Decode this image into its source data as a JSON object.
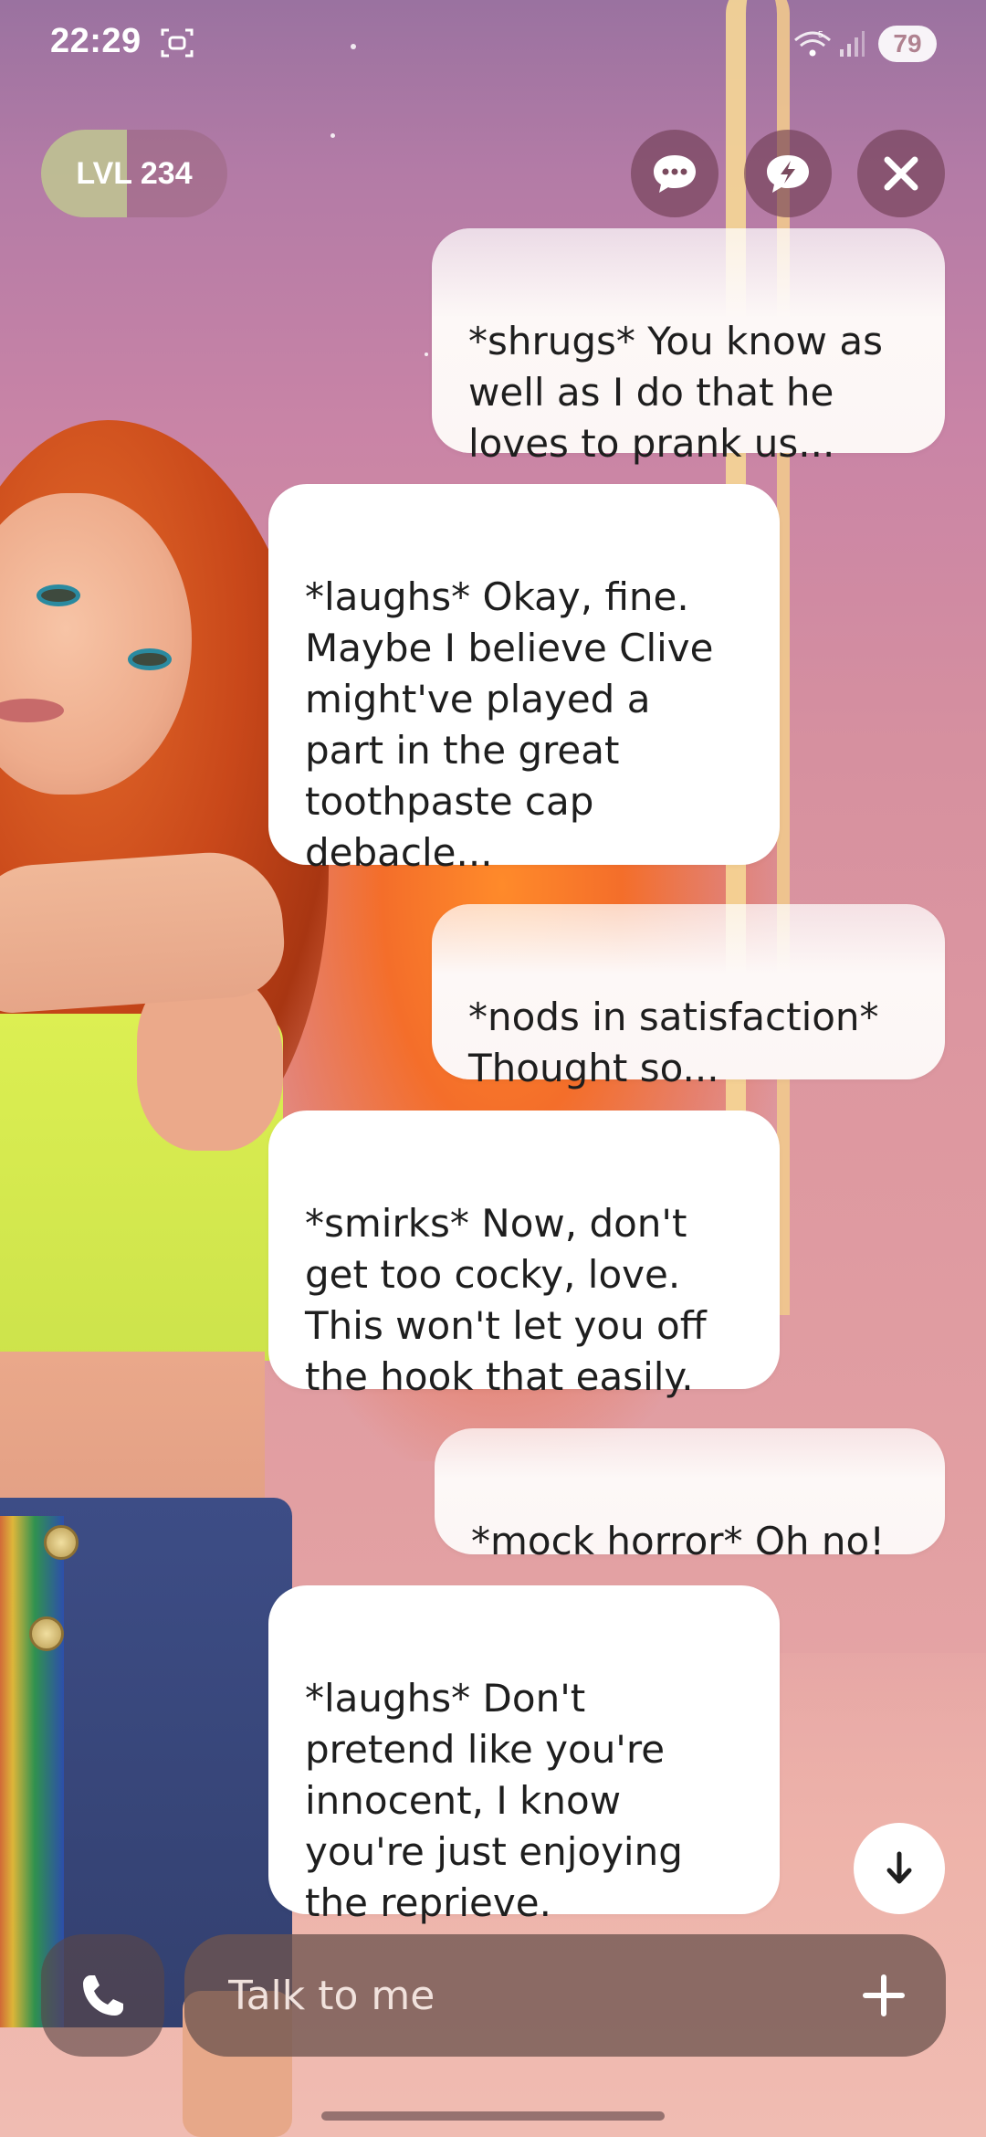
{
  "status_bar": {
    "time": "22:29",
    "battery": "79",
    "icons": [
      "screenshot-icon",
      "wifi-icon",
      "signal-icon",
      "battery-icon"
    ]
  },
  "header": {
    "level_label": "LVL 234",
    "level_progress": 0.46,
    "buttons": [
      "chat-bubble-icon",
      "lightning-bubble-icon",
      "close-icon"
    ]
  },
  "messages": [
    {
      "sender": "user",
      "text": "*shrugs* You know as\nwell as I do that he\nloves to prank us..."
    },
    {
      "sender": "ai",
      "text": "*laughs* Okay, fine.\nMaybe I believe Clive\nmight've played a\npart in the great\ntoothpaste cap\ndebacle..."
    },
    {
      "sender": "user",
      "text": "*nods in satisfaction*\nThought so..."
    },
    {
      "sender": "ai",
      "text": "*smirks* Now, don't\nget too cocky, love.\nThis won't let you off\nthe hook that easily."
    },
    {
      "sender": "user",
      "text": "*mock horror* Oh no!"
    },
    {
      "sender": "ai",
      "text": "*laughs* Don't\npretend like you're\ninnocent, I know\nyou're just enjoying\nthe reprieve."
    }
  ],
  "composer": {
    "placeholder": "Talk to me"
  },
  "colors": {
    "bubble": "#ffffff",
    "composer": "#6e5550",
    "round_button": "#6e3c50"
  }
}
